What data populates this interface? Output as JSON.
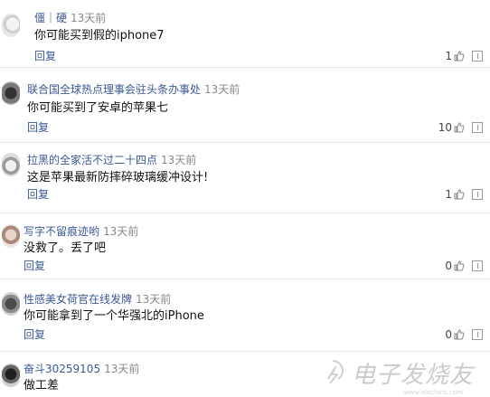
{
  "comments": [
    {
      "username": "僵｜硬",
      "time": "13天前",
      "content": "你可能买到假的iphone7",
      "reply": "回复",
      "likes": "1"
    },
    {
      "username": "联合国全球热点理事会驻头条办事处",
      "time": "13天前",
      "content": "你可能买到了安卓的苹果七",
      "reply": "回复",
      "likes": "10"
    },
    {
      "username": "拉黑的全家活不过二十四点",
      "time": "13天前",
      "content": "这是苹果最新防摔碎玻璃缓冲设计!",
      "reply": "回复",
      "likes": "1"
    },
    {
      "username": "写字不留痕迹哟",
      "time": "13天前",
      "content": "没救了。丢了吧",
      "reply": "回复",
      "likes": "0"
    },
    {
      "username": "性感美女荷官在线发牌",
      "time": "13天前",
      "content": "你可能拿到了一个华强北的iPhone",
      "reply": "回复",
      "likes": "0"
    },
    {
      "username": "奋斗30259105",
      "time": "13天前",
      "content": "做工差"
    }
  ],
  "watermark": {
    "text": "电子发烧友",
    "url": "www.elecfans.com"
  },
  "icons": {
    "like": "thumbs-up-icon",
    "report": "report-icon"
  },
  "colors": {
    "username": "#3b5998",
    "time": "#888888",
    "divider": "#e6e6e6"
  }
}
